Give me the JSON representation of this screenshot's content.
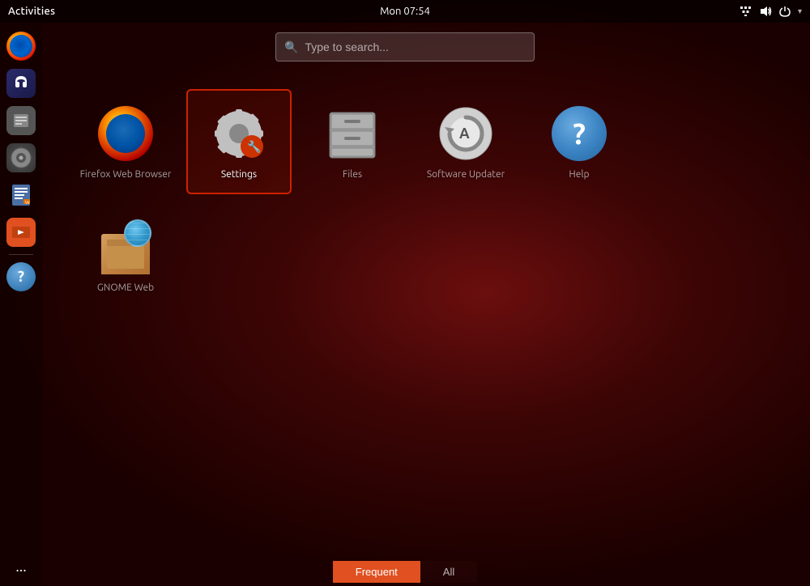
{
  "topbar": {
    "activities_label": "Activities",
    "clock": "Mon 07:54",
    "tray_icons": [
      "network-icon",
      "volume-icon",
      "power-icon"
    ]
  },
  "search": {
    "placeholder": "Type to search..."
  },
  "sidebar": {
    "items": [
      {
        "id": "firefox",
        "label": "Firefox"
      },
      {
        "id": "headphones",
        "label": "Headphones"
      },
      {
        "id": "files",
        "label": "Files"
      },
      {
        "id": "disk",
        "label": "Disks"
      },
      {
        "id": "writer",
        "label": "Writer"
      },
      {
        "id": "software",
        "label": "Software"
      }
    ],
    "bottom_icon": "more-dots"
  },
  "app_grid": {
    "rows": [
      [
        {
          "id": "firefox",
          "label": "Firefox Web Browser",
          "blurred": true
        },
        {
          "id": "settings",
          "label": "Settings",
          "selected": true
        },
        {
          "id": "files",
          "label": "Files",
          "blurred": true
        },
        {
          "id": "updater",
          "label": "Software Updater",
          "blurred": true
        },
        {
          "id": "help",
          "label": "Help",
          "blurred": true
        }
      ],
      [
        {
          "id": "globe",
          "label": "GNOME Web",
          "blurred": true
        }
      ]
    ]
  },
  "bottom_tabs": {
    "frequent_label": "Frequent",
    "all_label": "All",
    "active": "frequent"
  }
}
